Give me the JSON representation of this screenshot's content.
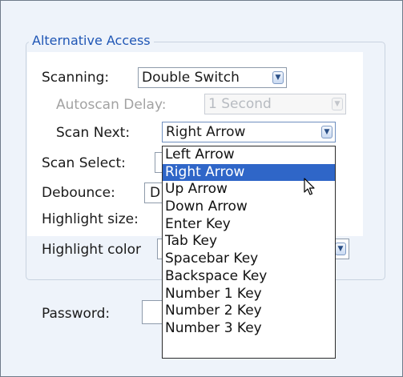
{
  "group": {
    "title": "Alternative Access"
  },
  "scanning": {
    "label": "Scanning:",
    "value": "Double Switch"
  },
  "autoscan_delay": {
    "label": "Autoscan Delay:",
    "value": "1 Second"
  },
  "scan_next": {
    "label": "Scan Next:",
    "value": "Right Arrow"
  },
  "scan_select": {
    "label": "Scan Select:"
  },
  "debounce": {
    "label": "Debounce:",
    "value_partial": "D"
  },
  "highlight_size": {
    "label": "Highlight size:"
  },
  "highlight_color": {
    "label": "Highlight color"
  },
  "password": {
    "label": "Password:"
  },
  "dropdown": {
    "selected": "Right Arrow",
    "options": [
      "Left Arrow",
      "Right Arrow",
      "Up Arrow",
      "Down Arrow",
      "Enter Key",
      "Tab Key",
      "Spacebar Key",
      "Backspace Key",
      "Number 1 Key",
      "Number 2 Key",
      "Number 3 Key"
    ]
  },
  "colors": {
    "selection": "#2f66c8",
    "legend_text": "#1f56b5",
    "background": "#eef3fa"
  },
  "icons": {
    "combo_arrow": "chevron-down-icon",
    "pointer": "mouse-pointer-icon"
  }
}
